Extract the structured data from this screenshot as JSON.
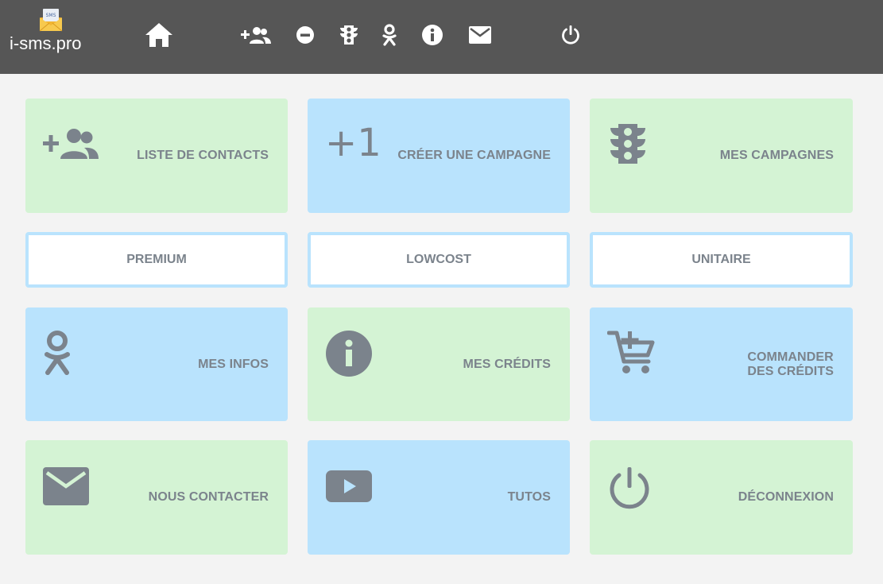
{
  "brand": {
    "name": "i-sms.pro",
    "logo_icon": "envelope-sms-icon"
  },
  "nav": [
    {
      "name": "home-icon"
    },
    {
      "name": "add-contacts-icon"
    },
    {
      "name": "minus-circle-icon"
    },
    {
      "name": "traffic-light-icon"
    },
    {
      "name": "odnoklassniki-icon"
    },
    {
      "name": "info-icon"
    },
    {
      "name": "mail-icon"
    },
    {
      "name": "power-icon"
    }
  ],
  "tiles": {
    "contacts": {
      "label": "LISTE DE CONTACTS",
      "icon": "add-contacts-icon"
    },
    "create_campaign": {
      "label": "CRÉER UNE CAMPAGNE",
      "icon": "plus-one-icon",
      "icon_text": "+1"
    },
    "my_campaigns": {
      "label": "MES CAMPAGNES",
      "icon": "traffic-light-icon"
    },
    "my_infos": {
      "label": "MES INFOS",
      "icon": "odnoklassniki-icon"
    },
    "my_credits": {
      "label": "MES CRÉDITS",
      "icon": "info-icon"
    },
    "order_credits": {
      "label_line1": "COMMANDER",
      "label_line2": "DES CRÉDITS",
      "icon": "add-to-cart-icon"
    },
    "contact_us": {
      "label": "NOUS CONTACTER",
      "icon": "mail-icon"
    },
    "tutos": {
      "label": "TUTOS",
      "icon": "youtube-icon"
    },
    "logout": {
      "label": "DÉCONNEXION",
      "icon": "power-icon"
    }
  },
  "plans": [
    {
      "label": "PREMIUM"
    },
    {
      "label": "LOWCOST"
    },
    {
      "label": "UNITAIRE"
    }
  ],
  "colors": {
    "topbar": "#565656",
    "green_tile": "#d4f3d4",
    "blue_tile": "#b9e3fd",
    "icon_gray": "#7b838c",
    "background": "#f3f3f3"
  }
}
